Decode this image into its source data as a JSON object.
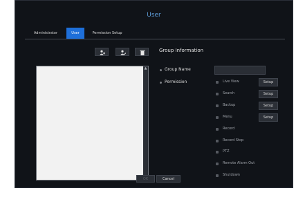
{
  "dialog": {
    "title": "User"
  },
  "tabs": [
    {
      "label": "Administrator",
      "active": false
    },
    {
      "label": "User",
      "active": true
    },
    {
      "label": "Permission Setup",
      "active": false
    }
  ],
  "toolbar": {
    "icons": [
      "add-user-icon",
      "edit-user-icon",
      "delete-icon"
    ]
  },
  "group_info": {
    "title": "Group Information",
    "group_name_label": "Group Name",
    "group_name_value": "",
    "permission_label": "Permission"
  },
  "permissions": [
    {
      "label": "Live View",
      "setup": "Setup"
    },
    {
      "label": "Search",
      "setup": "Setup"
    },
    {
      "label": "Backup",
      "setup": "Setup"
    },
    {
      "label": "Menu",
      "setup": "Setup"
    },
    {
      "label": "Record"
    },
    {
      "label": "Record Stop"
    },
    {
      "label": "PTZ"
    },
    {
      "label": "Remote Alarm Out"
    },
    {
      "label": "Shutdown"
    }
  ],
  "buttons": {
    "ok": "OK",
    "cancel": "Cancel"
  },
  "colors": {
    "accent": "#1e6fd9",
    "title": "#5d9bd6",
    "background": "#101318"
  }
}
